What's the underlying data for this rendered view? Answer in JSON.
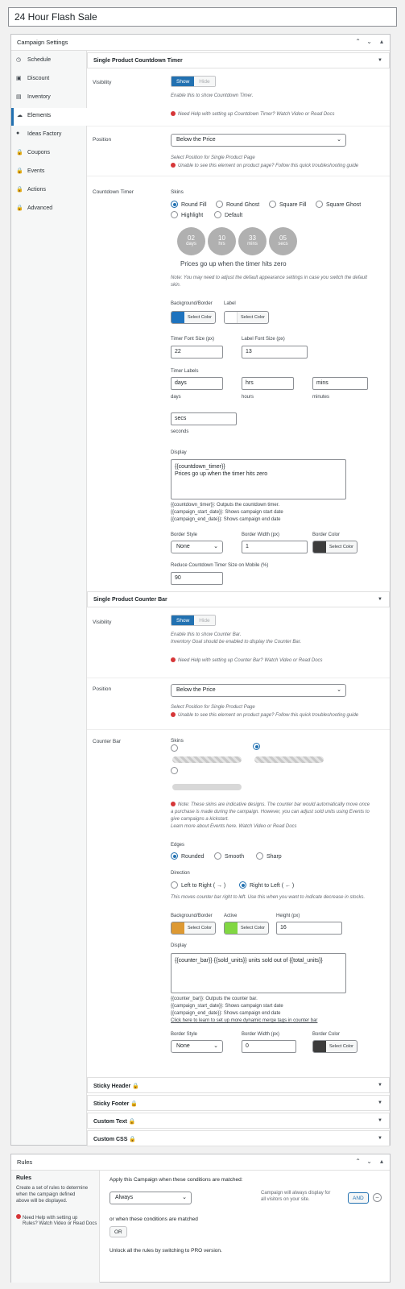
{
  "page_title": "24 Hour Flash Sale",
  "campaign_settings": {
    "title": "Campaign Settings",
    "nav": [
      {
        "label": "Schedule"
      },
      {
        "label": "Discount"
      },
      {
        "label": "Inventory"
      },
      {
        "label": "Elements"
      },
      {
        "label": "Ideas Factory"
      },
      {
        "label": "Coupons"
      },
      {
        "label": "Events"
      },
      {
        "label": "Actions"
      },
      {
        "label": "Advanced"
      }
    ]
  },
  "countdown": {
    "header": "Single Product Countdown Timer",
    "visibility_label": "Visibility",
    "show": "Show",
    "hide": "Hide",
    "visibility_help": "Enable this to show Countdown Timer.",
    "visibility_link_help": "Need Help with setting up Countdown Timer? Watch Video or Read Docs",
    "position_label": "Position",
    "position_value": "Below the Price",
    "position_help": "Select Position for Single Product Page",
    "position_warn": "Unable to see this element on product page? Follow this quick troubleshooting guide",
    "timer_label": "Countdown Timer",
    "skins_label": "Skins",
    "skins": [
      "Round Fill",
      "Round Ghost",
      "Square Fill",
      "Square Ghost",
      "Highlight",
      "Default"
    ],
    "preview": [
      {
        "n": "02",
        "u": "days"
      },
      {
        "n": "10",
        "u": "hrs"
      },
      {
        "n": "33",
        "u": "mins"
      },
      {
        "n": "05",
        "u": "secs"
      }
    ],
    "preview_text": "Prices go up when the timer hits zero",
    "note_line1": "Note: You may need to adjust the default appearance settings in case you switch the default",
    "note_line2": "skin.",
    "bg_border_label": "Background/Border",
    "label_label": "Label",
    "select_color": "Select Color",
    "bg_color": "#1e73be",
    "label_color": "#ffffff",
    "timer_font_label": "Timer Font Size (px)",
    "timer_font_value": "22",
    "label_font_label": "Label Font Size (px)",
    "label_font_value": "13",
    "timer_labels_label": "Timer Labels",
    "labels": [
      {
        "value": "days",
        "caption": "days"
      },
      {
        "value": "hrs",
        "caption": "hours"
      },
      {
        "value": "mins",
        "caption": "minutes"
      },
      {
        "value": "secs",
        "caption": "seconds"
      }
    ],
    "display_label": "Display",
    "display_line1": "{{countdown_timer}}",
    "display_line2": "Prices go up when the timer hits zero",
    "merge1": "{{countdown_timer}}: Outputs the countdown timer.",
    "merge2": "{{campaign_start_date}}: Shows campaign start date",
    "merge3": "{{campaign_end_date}}: Shows campaign end date",
    "border_style_label": "Border Style",
    "border_style_value": "None",
    "border_width_label": "Border Width (px)",
    "border_width_value": "1",
    "border_color_label": "Border Color",
    "border_color": "#3c3c3c",
    "reduce_label": "Reduce Countdown Timer Size on Mobile (%)",
    "reduce_value": "90"
  },
  "counter": {
    "header": "Single Product Counter Bar",
    "visibility_label": "Visibility",
    "show": "Show",
    "hide": "Hide",
    "help1": "Enable this to show Counter Bar.",
    "help2": "Inventory Goal should be enabled to display the Counter Bar.",
    "help_link": "Need Help with setting up Counter Bar? Watch Video or Read Docs",
    "position_label": "Position",
    "position_value": "Below the Price",
    "position_help": "Select Position for Single Product Page",
    "position_warn": "Unable to see this element on product page? Follow this quick troubleshooting guide",
    "bar_label": "Counter Bar",
    "skins_label": "Skins",
    "note1": "Note: These skins are indicative designs. The counter bar would automatically move once",
    "note2": "a purchase is made during the campaign. However, you can adjust sold units using Events to",
    "note3": "give campaigns a kickstart.",
    "note4": "Learn more about Events here. Watch Video or Read Docs",
    "edges_label": "Edges",
    "edges": [
      "Rounded",
      "Smooth",
      "Sharp"
    ],
    "direction_label": "Direction",
    "dir_ltr": "Left to Right (",
    "dir_rtl": "Right to Left (",
    "dir_help": "This moves counter bar right to left. Use this when you want to indicate decrease in stocks.",
    "bg_label": "Background/Border",
    "active_label": "Active",
    "height_label": "Height (px)",
    "height_value": "16",
    "select_color": "Select Color",
    "bg_color": "#dd9933",
    "active_color": "#81d742",
    "display_label": "Display",
    "display_value": "{{counter_bar}} {{sold_units}} units sold out of {{total_units}}",
    "merge1": "{{counter_bar}}: Outputs the counter bar.",
    "merge2": "{{campaign_start_date}}: Shows campaign start date",
    "merge3": "{{campaign_end_date}}: Shows campaign end date",
    "merge_link": "Click here to learn to set up more dynamic merge tags in counter bar",
    "border_style_label": "Border Style",
    "border_style_value": "None",
    "border_width_label": "Border Width (px)",
    "border_width_value": "0",
    "border_color_label": "Border Color",
    "border_color": "#3c3c3c"
  },
  "locked_sections": [
    "Sticky Header",
    "Sticky Footer",
    "Custom Text",
    "Custom CSS"
  ],
  "rules": {
    "title": "Rules",
    "side_title": "Rules",
    "side_desc1": "Create a set of rules to determine",
    "side_desc2": "when the campaign defined",
    "side_desc3": "above will be displayed.",
    "side_help1": "Need Help with setting up",
    "side_help2": "Rules? Watch Video or Read Docs",
    "apply_label": "Apply this Campaign when these conditions are matched:",
    "condition_value": "Always",
    "condition_desc1": "Campaign will always display for",
    "condition_desc2": "all visitors on your site.",
    "and_button": "AND",
    "or_label": "or when these conditions are matched",
    "or_button": "OR",
    "unlock_text": "Unlock all the rules by switching to PRO version."
  }
}
